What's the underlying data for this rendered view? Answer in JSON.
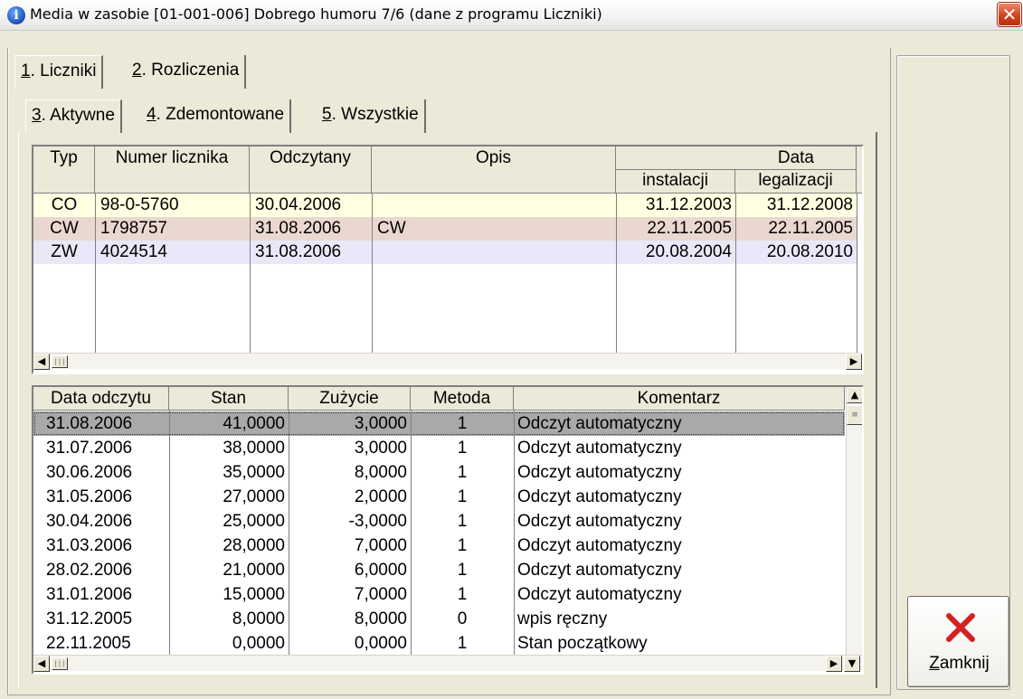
{
  "window": {
    "title": "Media w zasobie [01-001-006] Dobrego humoru 7/6 (dane z programu Liczniki)",
    "title_icon": "info-icon",
    "close_icon": "close-icon"
  },
  "tabs": [
    {
      "num": "1",
      "label": ". Liczniki"
    },
    {
      "num": "2",
      "label": ". Rozliczenia"
    }
  ],
  "subtabs": [
    {
      "num": "3",
      "label": ". Aktywne"
    },
    {
      "num": "4",
      "label": ". Zdemontowane"
    },
    {
      "num": "5",
      "label": ". Wszystkie"
    }
  ],
  "meters": {
    "headers": {
      "typ": "Typ",
      "numer": "Numer licznika",
      "odczytany": "Odczytany",
      "opis": "Opis",
      "data": "Data",
      "instalacji": "instalacji",
      "legalizacji": "legalizacji"
    },
    "rows": [
      {
        "typ": "CO",
        "numer": "98-0-5760",
        "odczytany": "30.04.2006",
        "opis": "",
        "instalacji": "31.12.2003",
        "legalizacji": "31.12.2008",
        "bg": "#ffffe1"
      },
      {
        "typ": "CW",
        "numer": "1798757",
        "odczytany": "31.08.2006",
        "opis": "CW",
        "instalacji": "22.11.2005",
        "legalizacji": "22.11.2005",
        "bg": "#ead8d0"
      },
      {
        "typ": "ZW",
        "numer": "4024514",
        "odczytany": "31.08.2006",
        "opis": "",
        "instalacji": "20.08.2004",
        "legalizacji": "20.08.2010",
        "bg": "#e9e8f8"
      }
    ]
  },
  "readings": {
    "headers": {
      "data": "Data odczytu",
      "stan": "Stan",
      "zuzycie": "Zużycie",
      "metoda": "Metoda",
      "komentarz": "Komentarz"
    },
    "rows": [
      {
        "data": "31.08.2006",
        "stan": "41,0000",
        "zuzycie": "3,0000",
        "metoda": "1",
        "komentarz": "Odczyt automatyczny"
      },
      {
        "data": "31.07.2006",
        "stan": "38,0000",
        "zuzycie": "3,0000",
        "metoda": "1",
        "komentarz": "Odczyt automatyczny"
      },
      {
        "data": "30.06.2006",
        "stan": "35,0000",
        "zuzycie": "8,0000",
        "metoda": "1",
        "komentarz": "Odczyt automatyczny"
      },
      {
        "data": "31.05.2006",
        "stan": "27,0000",
        "zuzycie": "2,0000",
        "metoda": "1",
        "komentarz": "Odczyt automatyczny"
      },
      {
        "data": "30.04.2006",
        "stan": "25,0000",
        "zuzycie": "-3,0000",
        "metoda": "1",
        "komentarz": "Odczyt automatyczny"
      },
      {
        "data": "31.03.2006",
        "stan": "28,0000",
        "zuzycie": "7,0000",
        "metoda": "1",
        "komentarz": "Odczyt automatyczny"
      },
      {
        "data": "28.02.2006",
        "stan": "21,0000",
        "zuzycie": "6,0000",
        "metoda": "1",
        "komentarz": "Odczyt automatyczny"
      },
      {
        "data": "31.01.2006",
        "stan": "15,0000",
        "zuzycie": "7,0000",
        "metoda": "1",
        "komentarz": "Odczyt automatyczny"
      },
      {
        "data": "31.12.2005",
        "stan": "8,0000",
        "zuzycie": "8,0000",
        "metoda": "0",
        "komentarz": "wpis ręczny"
      },
      {
        "data": "22.11.2005",
        "stan": "0,0000",
        "zuzycie": "0,0000",
        "metoda": "1",
        "komentarz": "Stan początkowy"
      }
    ],
    "selected_bg": "#a9a9a9"
  },
  "close_button": {
    "underlined": "Z",
    "rest": "amknij",
    "icon": "x-icon",
    "icon_color": "#d42020"
  }
}
